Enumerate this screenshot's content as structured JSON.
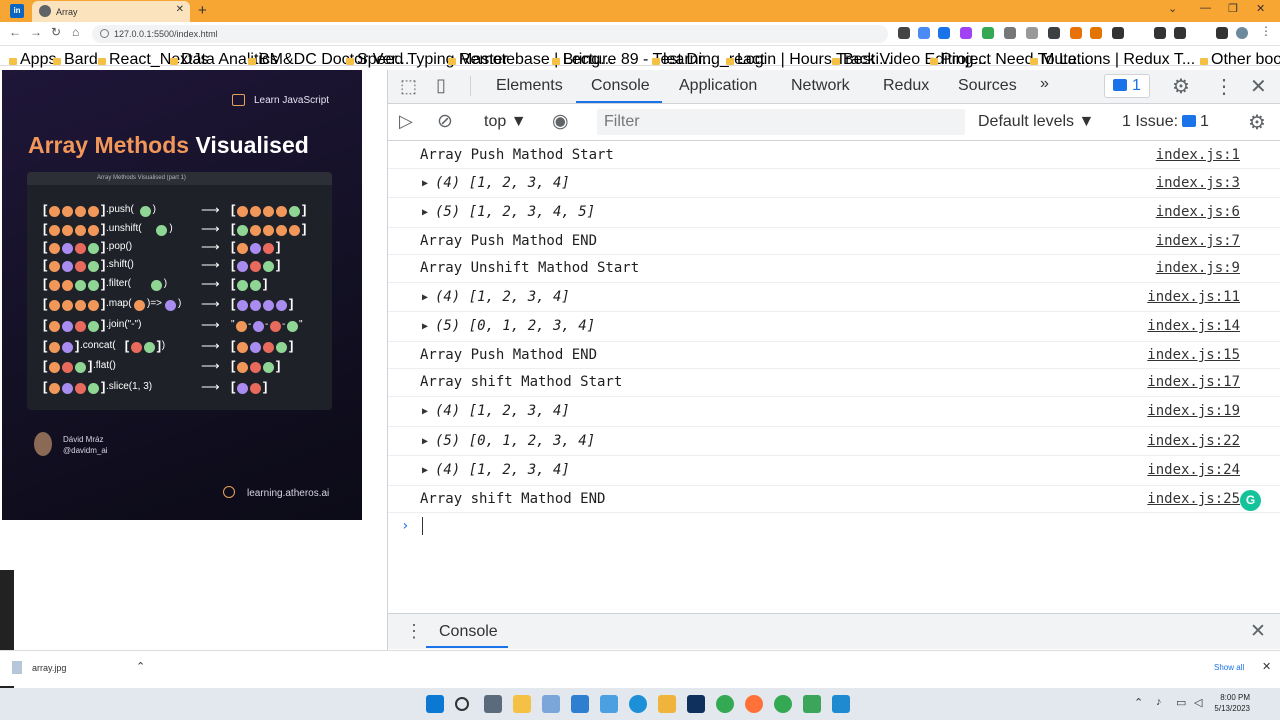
{
  "browser": {
    "tab_title": "Array",
    "url": "127.0.0.1:5500/index.html",
    "bookmarks": [
      "Apps",
      "Bard",
      "React_NextJs",
      "Data Analitics",
      "BM&DC Doctor Ver...",
      "Speed Typing Master",
      "Remotebase | Bring...",
      "Lecture 89 - Test Dr...",
      "learning_react",
      "Login | Hours Tracki...",
      "Best Video Editing...",
      "Project Need To Le...",
      "Mutations | Redux T..."
    ],
    "other_bookmarks": "Other bookmarks"
  },
  "card": {
    "badge": "Learn JavaScript",
    "title_accent": "Array Methods",
    "title_rest": "Visualised",
    "mini_title": "Array Methods Visualised (part 1)",
    "methods": [
      ".push(",
      ".unshift(",
      ".pop()",
      ".shift()",
      ".filter(",
      ".map(",
      ".join(\"-\")",
      ".concat(",
      ".flat()",
      ".slice(1, 3)"
    ],
    "map_arrow": ")=>",
    "author_name": "Dávid Mráz",
    "author_handle": "@davidm_ai",
    "site": "learning.atheros.ai",
    "colors": {
      "orange": "#f2975a",
      "green": "#8fd694",
      "purple": "#a98cf0",
      "red": "#e86a5c"
    }
  },
  "devtools": {
    "tabs": [
      "Elements",
      "Console",
      "Application",
      "Network",
      "Redux",
      "Sources"
    ],
    "more_tabs": "»",
    "issues_count": "1",
    "context": "top ▼",
    "filter_placeholder": "Filter",
    "levels": "Default levels ▼",
    "issue_label": "1 Issue:",
    "issue_count_2": "1",
    "console_lines": [
      {
        "msg": "Array Push Mathod Start",
        "src": "index.js:1",
        "obj": false
      },
      {
        "msg": "(4) [1, 2, 3, 4]",
        "src": "index.js:3",
        "obj": true
      },
      {
        "msg": "(5) [1, 2, 3, 4, 5]",
        "src": "index.js:6",
        "obj": true
      },
      {
        "msg": "Array Push Mathod END",
        "src": "index.js:7",
        "obj": false
      },
      {
        "msg": "Array Unshift Mathod Start",
        "src": "index.js:9",
        "obj": false
      },
      {
        "msg": "(4) [1, 2, 3, 4]",
        "src": "index.js:11",
        "obj": true
      },
      {
        "msg": "(5) [0, 1, 2, 3, 4]",
        "src": "index.js:14",
        "obj": true
      },
      {
        "msg": "Array Push Mathod END",
        "src": "index.js:15",
        "obj": false
      },
      {
        "msg": "Array shift Mathod Start",
        "src": "index.js:17",
        "obj": false
      },
      {
        "msg": "(4) [1, 2, 3, 4]",
        "src": "index.js:19",
        "obj": true
      },
      {
        "msg": "(5) [0, 1, 2, 3, 4]",
        "src": "index.js:22",
        "obj": true
      },
      {
        "msg": "(4) [1, 2, 3, 4]",
        "src": "index.js:24",
        "obj": true
      },
      {
        "msg": "Array shift Mathod END",
        "src": "index.js:25",
        "obj": false
      }
    ],
    "drawer_tab": "Console"
  },
  "downloads": {
    "file": "array.jpg",
    "show_all": "Show all"
  },
  "taskbar": {
    "time": "8:00 PM",
    "date": "5/13/2023"
  }
}
